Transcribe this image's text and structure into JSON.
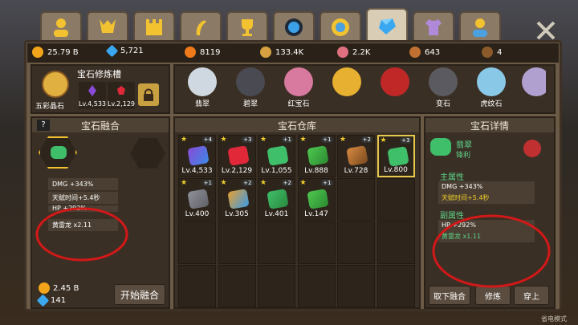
{
  "tabs": [
    {
      "icon": "user-icon"
    },
    {
      "icon": "trophy-head-icon"
    },
    {
      "icon": "castle-icon"
    },
    {
      "icon": "scroll-icon"
    },
    {
      "icon": "cup-icon"
    },
    {
      "icon": "orb-icon"
    },
    {
      "icon": "medal-icon"
    },
    {
      "icon": "gem-icon",
      "active": true
    },
    {
      "icon": "shirt-icon"
    },
    {
      "icon": "friend-icon"
    }
  ],
  "resources": [
    "25.79 B",
    "5,721",
    "8119",
    "133.4K",
    "2.2K",
    "643",
    "4"
  ],
  "slot": {
    "title": "宝石修炼槽",
    "stone_label": "五彩晶石",
    "gem1_lv": "Lv.4,533",
    "gem2_lv": "Lv.2,129"
  },
  "dragons": [
    "翡翠",
    "碧翠",
    "红宝石",
    "",
    "",
    "变石",
    "虎纹石"
  ],
  "fusion": {
    "title": "宝石融合",
    "q": "?",
    "stats": [
      "DMG +343%",
      "天赋时间+5.4秒",
      "HP +292%",
      "黄雷龙 x2.11"
    ],
    "gold": "2.45 B",
    "gems": "141",
    "start": "开始融合"
  },
  "warehouse": {
    "title": "宝石仓库",
    "items": [
      {
        "lv": "Lv.4,533",
        "b": "+4"
      },
      {
        "lv": "Lv.2,129",
        "b": "+3"
      },
      {
        "lv": "Lv.1,055",
        "b": "+1"
      },
      {
        "lv": "Lv.888",
        "b": "+1"
      },
      {
        "lv": "Lv.728",
        "b": "+2"
      },
      {
        "lv": "Lv.800",
        "b": "+3"
      },
      {
        "lv": "Lv.400",
        "b": "+1"
      },
      {
        "lv": "Lv.305",
        "b": "+2"
      },
      {
        "lv": "Lv.401",
        "b": "+2"
      },
      {
        "lv": "Lv.147",
        "b": "+1"
      }
    ]
  },
  "detail": {
    "title": "宝石详情",
    "name": "翡翠",
    "sub": "锋利",
    "main_title": "主属性",
    "main": [
      "DMG +343%",
      "天赋时间+5.4秒"
    ],
    "sub_title": "副属性",
    "subs": [
      "HP +292%",
      "黄雷龙 x1.11"
    ],
    "btns": [
      "取下融合",
      "修炼",
      "穿上"
    ]
  },
  "footer": "省电模式"
}
